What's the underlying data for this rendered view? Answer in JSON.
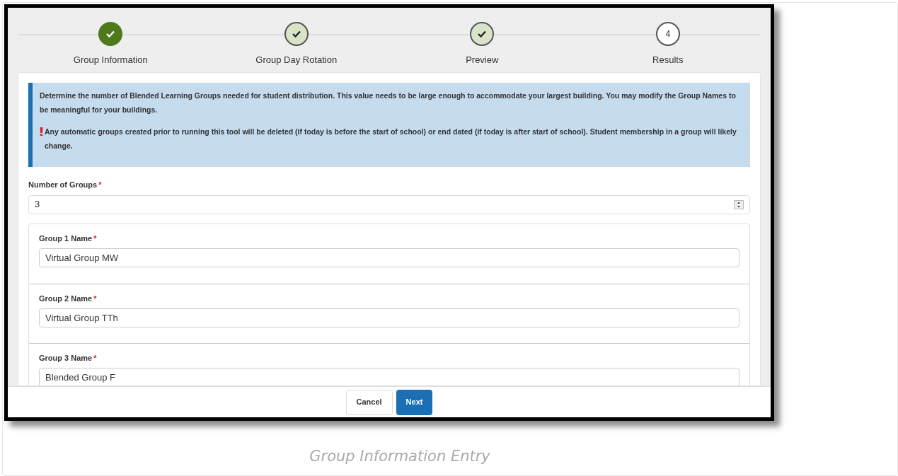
{
  "steps": [
    {
      "label": "Group Information",
      "selected": true,
      "complete": true
    },
    {
      "label": "Group Day Rotation",
      "selected": false,
      "complete": true
    },
    {
      "label": "Preview",
      "selected": false,
      "complete": true
    },
    {
      "label": "Results",
      "selected": false,
      "complete": false,
      "number": "4"
    }
  ],
  "info": {
    "message": "Determine the number of Blended Learning Groups needed for student distribution. This value needs to be large enough to accommodate your largest building. You may modify the Group Names to be meaningful for your buildings.",
    "warning": "Any automatic groups created prior to running this tool will be deleted (if today is before the start of school) or end dated (if today is after start of school). Student membership in a group will likely change."
  },
  "number_of_groups": {
    "label": "Number of Groups",
    "required_mark": "*",
    "value": "3"
  },
  "groups": [
    {
      "label": "Group 1 Name",
      "required_mark": "*",
      "value": "Virtual Group MW"
    },
    {
      "label": "Group 2 Name",
      "required_mark": "*",
      "value": "Virtual Group TTh"
    },
    {
      "label": "Group 3 Name",
      "required_mark": "*",
      "value": "Blended Group F"
    }
  ],
  "buttons": [
    {
      "label": "Cancel",
      "kind": "secondary"
    },
    {
      "label": "Next",
      "kind": "primary"
    }
  ],
  "caption": "Group Information Entry"
}
